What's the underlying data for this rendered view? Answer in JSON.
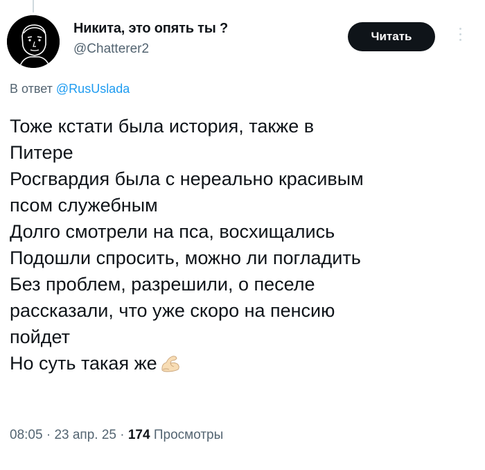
{
  "author": {
    "display_name": "Никита, это опять ты ?",
    "handle": "@Chatterer2",
    "avatar_icon": "avatar-portrait"
  },
  "actions": {
    "read_label": "Читать",
    "more_icon": "more-vertical-icon"
  },
  "reply": {
    "prefix": "В ответ",
    "mention": "@RusUslada"
  },
  "tweet": {
    "lines": [
      "Тоже кстати была история, также в",
      "Питере",
      "Росгвардия была с нереально красивым",
      "псом служебным",
      "Долго смотрели на пса, восхищались",
      "Подошли спросить, можно ли погладить",
      "Без проблем, разрешили, о песеле",
      "рассказали, что уже скоро на пенсию",
      "пойдет",
      "Но суть такая же"
    ],
    "emoji": "flexed-biceps-icon"
  },
  "meta": {
    "time": "08:05",
    "date": "23 апр. 25",
    "views_count": "174",
    "views_label": "Просмотры",
    "separator": "·"
  },
  "colors": {
    "text": "#0f1419",
    "secondary": "#536471",
    "link": "#1d9bf0",
    "button_bg": "#0f1419"
  }
}
